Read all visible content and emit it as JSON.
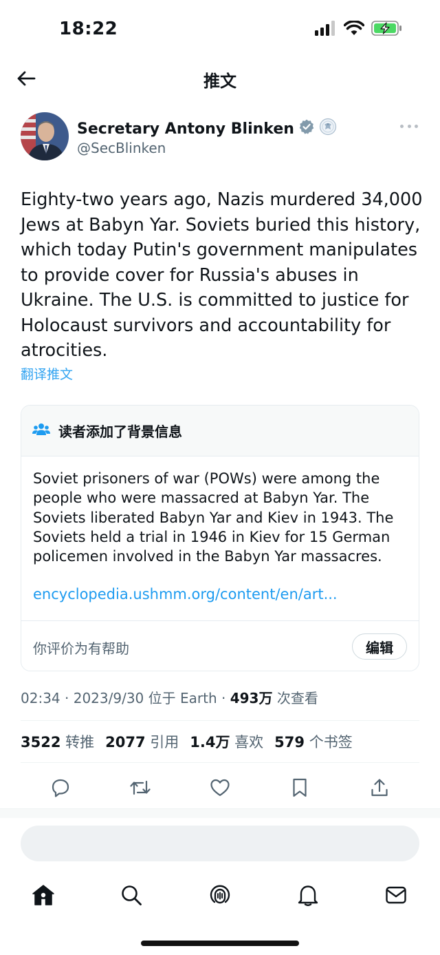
{
  "status_bar": {
    "time": "18:22"
  },
  "header": {
    "title": "推文"
  },
  "tweet": {
    "author_name": "Secretary Antony Blinken",
    "author_handle": "@SecBlinken",
    "text": "Eighty-two years ago, Nazis murdered 34,000 Jews at Babyn Yar. Soviets buried this history, which today Putin's government manipulates to provide cover for Russia's abuses in Ukraine. The U.S. is committed to justice for Holocaust survivors and accountability for atrocities.",
    "translate_label": "翻译推文"
  },
  "community_note": {
    "title": "读者添加了背景信息",
    "body": "Soviet prisoners of war (POWs) were among the people who were massacred at Babyn Yar. The Soviets liberated Babyn Yar and Kiev in 1943. The Soviets held a trial in 1946 in Kiev for 15 German policemen involved in the Babyn Yar massacres.",
    "link": "encyclopedia.ushmm.org/content/en/art...",
    "rating_question": "你评价为有帮助",
    "edit_label": "编辑"
  },
  "meta": {
    "time": "02:34",
    "sep1": "·",
    "date": "2023/9/30",
    "location": "位于 Earth",
    "sep2": "·",
    "views_count": "493万",
    "views_label": "次查看"
  },
  "stats": {
    "retweets_count": "3522",
    "retweets_label": "转推",
    "quotes_count": "2077",
    "quotes_label": "引用",
    "likes_count": "1.4万",
    "likes_label": "喜欢",
    "bookmarks_count": "579",
    "bookmarks_label": "个书签"
  },
  "colors": {
    "link": "#1d9bf0",
    "secondary_text": "#536471",
    "verified_badge": "#829aab"
  },
  "icons": [
    "back-arrow-icon",
    "verified-badge-icon",
    "state-department-seal-icon",
    "more-icon",
    "people-icon",
    "reply-icon",
    "retweet-icon",
    "like-icon",
    "bookmark-icon",
    "share-icon",
    "home-icon",
    "search-icon",
    "spaces-icon",
    "notifications-icon",
    "messages-icon"
  ]
}
